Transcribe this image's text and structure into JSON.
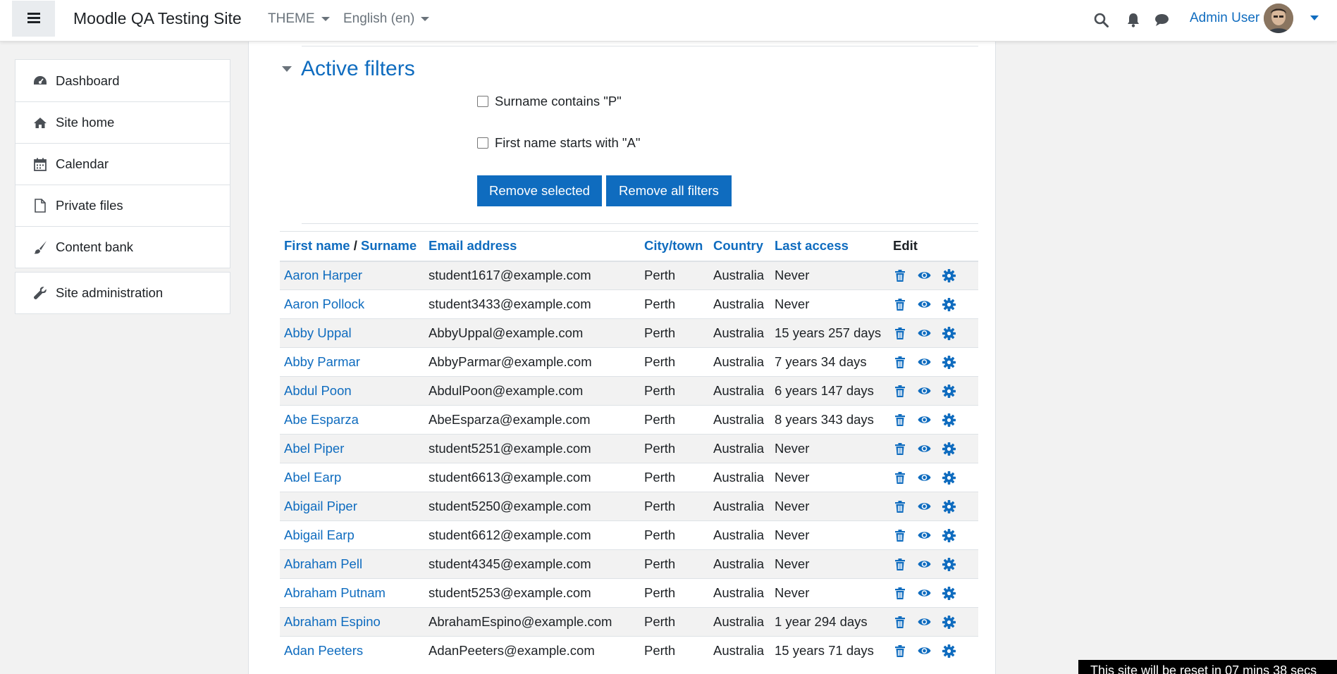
{
  "navbar": {
    "site_name": "Moodle QA Testing Site",
    "theme_label": "THEME",
    "language_label": "English (en)",
    "user_name": "Admin User"
  },
  "sidebar": {
    "items": [
      {
        "label": "Dashboard",
        "icon": "dashboard-icon"
      },
      {
        "label": "Site home",
        "icon": "home-icon"
      },
      {
        "label": "Calendar",
        "icon": "calendar-icon"
      },
      {
        "label": "Private files",
        "icon": "file-icon"
      },
      {
        "label": "Content bank",
        "icon": "paintbrush-icon"
      }
    ],
    "admin_item": {
      "label": "Site administration",
      "icon": "wrench-icon"
    }
  },
  "filters": {
    "heading": "Active filters",
    "items": [
      {
        "label": "Surname contains \"P\"",
        "checked": false
      },
      {
        "label": "First name starts with \"A\"",
        "checked": false
      }
    ],
    "remove_selected_label": "Remove selected",
    "remove_all_label": "Remove all filters"
  },
  "table": {
    "headers": {
      "first_name": "First name",
      "separator": " / ",
      "surname": "Surname",
      "email": "Email address",
      "city": "City/town",
      "country": "Country",
      "last_access": "Last access",
      "edit": "Edit"
    },
    "rows": [
      {
        "name": "Aaron Harper",
        "email": "student1617@example.com",
        "city": "Perth",
        "country": "Australia",
        "last_access": "Never"
      },
      {
        "name": "Aaron Pollock",
        "email": "student3433@example.com",
        "city": "Perth",
        "country": "Australia",
        "last_access": "Never"
      },
      {
        "name": "Abby Uppal",
        "email": "AbbyUppal@example.com",
        "city": "Perth",
        "country": "Australia",
        "last_access": "15 years 257 days"
      },
      {
        "name": "Abby Parmar",
        "email": "AbbyParmar@example.com",
        "city": "Perth",
        "country": "Australia",
        "last_access": "7 years 34 days"
      },
      {
        "name": "Abdul Poon",
        "email": "AbdulPoon@example.com",
        "city": "Perth",
        "country": "Australia",
        "last_access": "6 years 147 days"
      },
      {
        "name": "Abe Esparza",
        "email": "AbeEsparza@example.com",
        "city": "Perth",
        "country": "Australia",
        "last_access": "8 years 343 days"
      },
      {
        "name": "Abel Piper",
        "email": "student5251@example.com",
        "city": "Perth",
        "country": "Australia",
        "last_access": "Never"
      },
      {
        "name": "Abel Earp",
        "email": "student6613@example.com",
        "city": "Perth",
        "country": "Australia",
        "last_access": "Never"
      },
      {
        "name": "Abigail Piper",
        "email": "student5250@example.com",
        "city": "Perth",
        "country": "Australia",
        "last_access": "Never"
      },
      {
        "name": "Abigail Earp",
        "email": "student6612@example.com",
        "city": "Perth",
        "country": "Australia",
        "last_access": "Never"
      },
      {
        "name": "Abraham Pell",
        "email": "student4345@example.com",
        "city": "Perth",
        "country": "Australia",
        "last_access": "Never"
      },
      {
        "name": "Abraham Putnam",
        "email": "student5253@example.com",
        "city": "Perth",
        "country": "Australia",
        "last_access": "Never"
      },
      {
        "name": "Abraham Espino",
        "email": "AbrahamEspino@example.com",
        "city": "Perth",
        "country": "Australia",
        "last_access": "1 year 294 days"
      },
      {
        "name": "Adan Peeters",
        "email": "AdanPeeters@example.com",
        "city": "Perth",
        "country": "Australia",
        "last_access": "15 years 71 days"
      }
    ]
  },
  "reset_notice": "This site will be reset in 07 mins 38 secs",
  "colors": {
    "accent": "#0f6cbf",
    "text": "#1d2125",
    "stripe": "#f2f2f2"
  }
}
